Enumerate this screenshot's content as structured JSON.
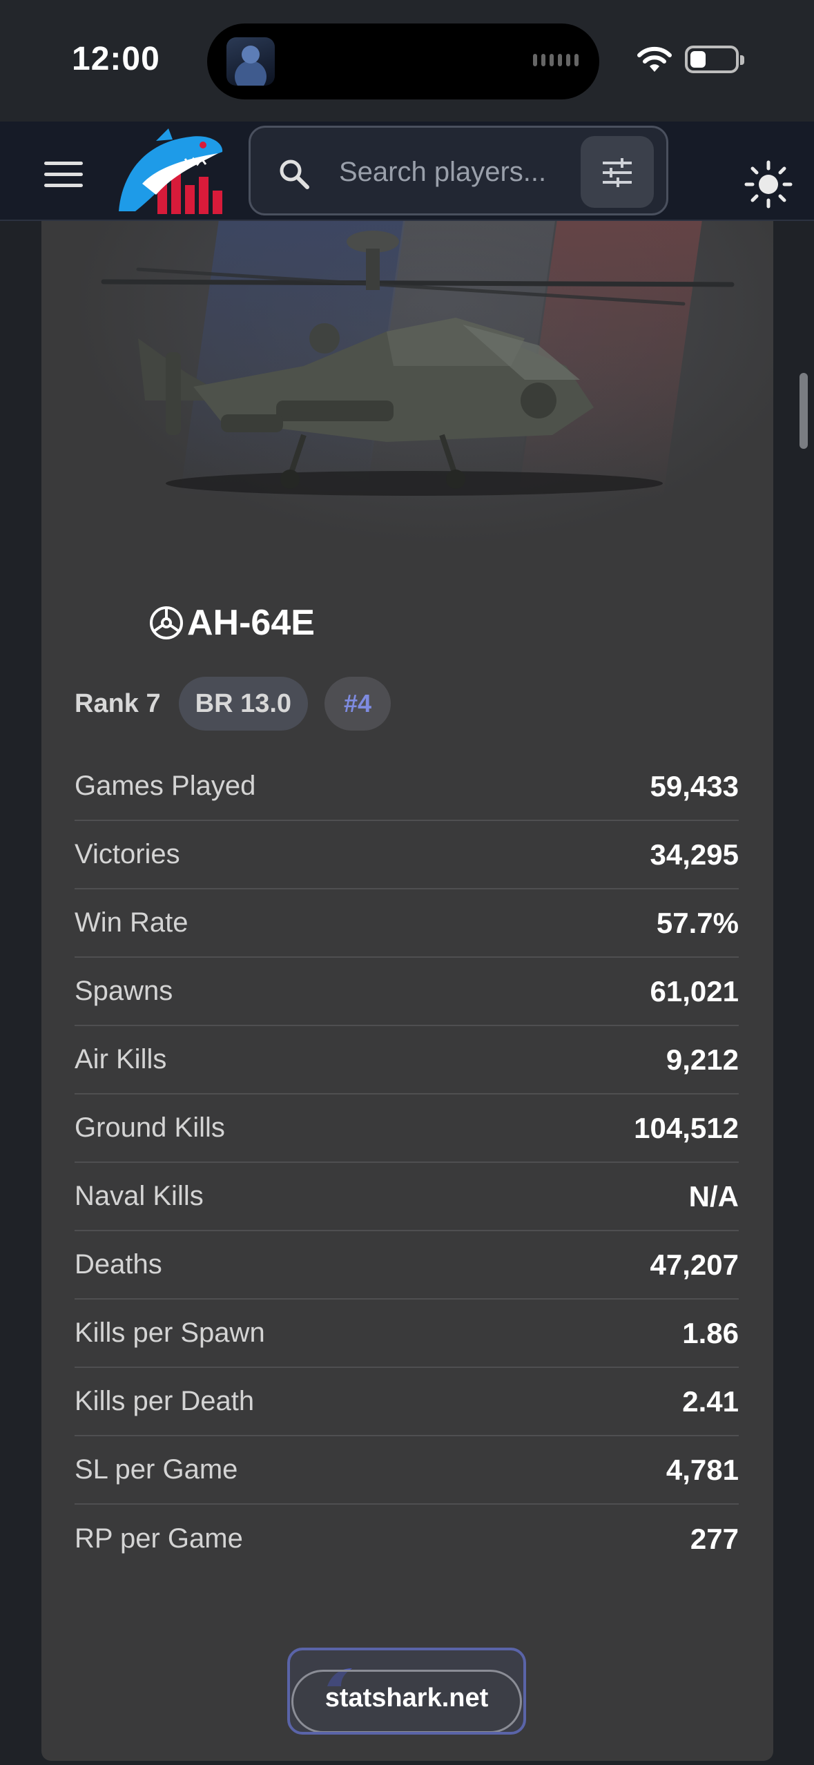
{
  "status_bar": {
    "time": "12:00"
  },
  "header": {
    "search_placeholder": "Search players...",
    "icons": [
      "menu-icon",
      "search-icon",
      "filter-icon",
      "sun-icon"
    ]
  },
  "vehicle": {
    "name": "AH-64E",
    "rank": "Rank 7",
    "br": "BR 13.0",
    "position": "#4"
  },
  "stats": [
    {
      "label": "Games Played",
      "value": "59,433"
    },
    {
      "label": "Victories",
      "value": "34,295"
    },
    {
      "label": "Win Rate",
      "value": "57.7%"
    },
    {
      "label": "Spawns",
      "value": "61,021"
    },
    {
      "label": "Air Kills",
      "value": "9,212"
    },
    {
      "label": "Ground Kills",
      "value": "104,512"
    },
    {
      "label": "Naval Kills",
      "value": "N/A"
    },
    {
      "label": "Deaths",
      "value": "47,207"
    },
    {
      "label": "Kills per Spawn",
      "value": "1.86"
    },
    {
      "label": "Kills per Death",
      "value": "2.41"
    },
    {
      "label": "SL per Game",
      "value": "4,781"
    },
    {
      "label": "RP per Game",
      "value": "277"
    }
  ],
  "footer": {
    "site": "statshark.net"
  },
  "colors": {
    "accent": "#7e8be0",
    "card": "#3a3a3b",
    "header": "#161b27"
  }
}
